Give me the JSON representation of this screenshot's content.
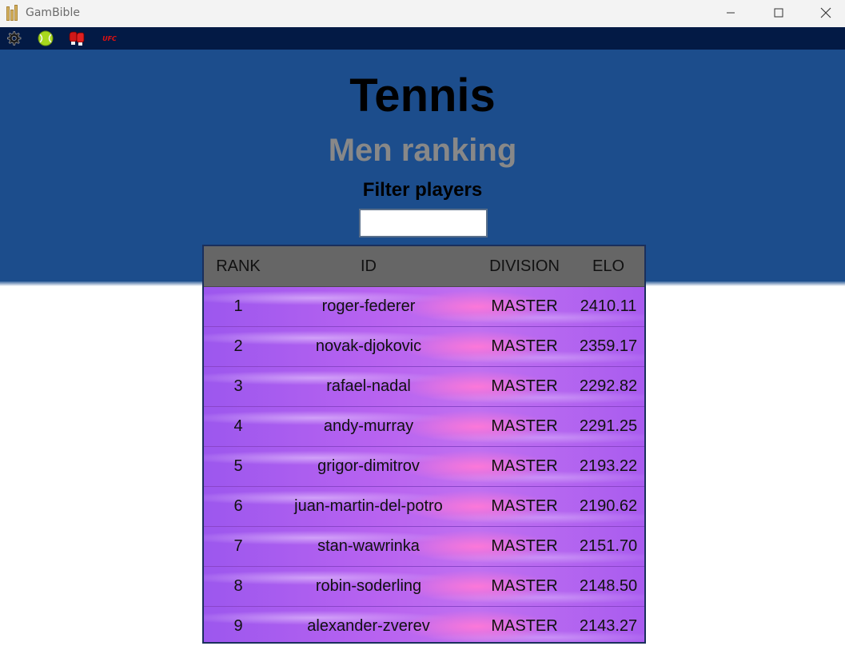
{
  "window": {
    "title": "GamBible"
  },
  "toolbar": {
    "icons": [
      "gear-icon",
      "tennis-ball-icon",
      "boxing-gloves-icon",
      "ufc-logo-icon"
    ],
    "ufc_text": "UFC"
  },
  "header": {
    "title": "Tennis",
    "subtitle": "Men ranking",
    "filter_label": "Filter players",
    "filter_value": ""
  },
  "table": {
    "columns": [
      "RANK",
      "ID",
      "DIVISION",
      "ELO"
    ],
    "rows": [
      {
        "rank": "1",
        "id": "roger-federer",
        "division": "MASTER",
        "elo": "2410.11"
      },
      {
        "rank": "2",
        "id": "novak-djokovic",
        "division": "MASTER",
        "elo": "2359.17"
      },
      {
        "rank": "3",
        "id": "rafael-nadal",
        "division": "MASTER",
        "elo": "2292.82"
      },
      {
        "rank": "4",
        "id": "andy-murray",
        "division": "MASTER",
        "elo": "2291.25"
      },
      {
        "rank": "5",
        "id": "grigor-dimitrov",
        "division": "MASTER",
        "elo": "2193.22"
      },
      {
        "rank": "6",
        "id": "juan-martin-del-potro",
        "division": "MASTER",
        "elo": "2190.62"
      },
      {
        "rank": "7",
        "id": "stan-wawrinka",
        "division": "MASTER",
        "elo": "2151.70"
      },
      {
        "rank": "8",
        "id": "robin-soderling",
        "division": "MASTER",
        "elo": "2148.50"
      },
      {
        "rank": "9",
        "id": "alexander-zverev",
        "division": "MASTER",
        "elo": "2143.27"
      }
    ]
  },
  "colors": {
    "header_bg": "#1c4d8c",
    "toolbar_bg": "#031a45",
    "row_purple": "#b45cf2",
    "row_pink_glow": "#ff78d7",
    "table_head_bg": "#666666"
  }
}
